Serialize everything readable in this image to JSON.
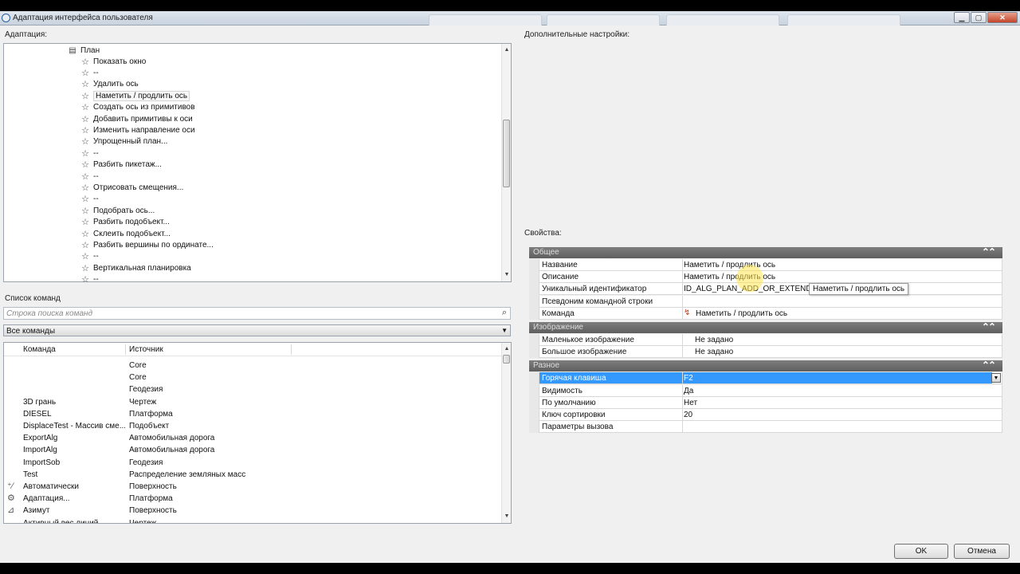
{
  "window": {
    "title": "Адаптация интерфейса пользователя",
    "controls": {
      "minimize": "▁",
      "maximize": "▢",
      "close": "✕"
    }
  },
  "left": {
    "adaptation_label": "Адаптация:",
    "tree": {
      "parent": {
        "icon": "panel-icon",
        "label": "План"
      },
      "items": [
        {
          "label": "Показать окно"
        },
        {
          "label": "--"
        },
        {
          "label": "Удалить ось"
        },
        {
          "label": "Наметить / продлить ось",
          "selected": true
        },
        {
          "label": "Создать ось из примитивов"
        },
        {
          "label": "Добавить примитивы к оси"
        },
        {
          "label": "Изменить направление оси"
        },
        {
          "label": "Упрощенный план..."
        },
        {
          "label": "--"
        },
        {
          "label": "Разбить пикетаж..."
        },
        {
          "label": "--"
        },
        {
          "label": "Отрисовать смещения..."
        },
        {
          "label": "--"
        },
        {
          "label": "Подобрать ось..."
        },
        {
          "label": "Разбить подобъект..."
        },
        {
          "label": "Склеить подобъект..."
        },
        {
          "label": "Разбить вершины по ординате..."
        },
        {
          "label": "--"
        },
        {
          "label": "Вертикальная планировка"
        },
        {
          "label": "--"
        }
      ],
      "star_glyph": "☆"
    },
    "commands_label": "Список команд",
    "search_placeholder": "Строка поиска команд",
    "filter_value": "Все команды",
    "grid": {
      "headers": [
        "Команда",
        "Источник"
      ],
      "rows": [
        {
          "command": "",
          "source": "Core",
          "icon": ""
        },
        {
          "command": "",
          "source": "Core",
          "icon": ""
        },
        {
          "command": "",
          "source": "Геодезия",
          "icon": ""
        },
        {
          "command": "3D грань",
          "source": "Чертеж",
          "icon": ""
        },
        {
          "command": "DIESEL",
          "source": "Платформа",
          "icon": ""
        },
        {
          "command": "DisplaceTest - Массив сме...",
          "source": "Подобъект",
          "icon": ""
        },
        {
          "command": "ExportAlg",
          "source": "Автомобильная дорога",
          "icon": ""
        },
        {
          "command": "ImportAlg",
          "source": "Автомобильная дорога",
          "icon": ""
        },
        {
          "command": "ImportSob",
          "source": "Геодезия",
          "icon": ""
        },
        {
          "command": "Test",
          "source": "Распределение земляных масс",
          "icon": ""
        },
        {
          "command": "Автоматически",
          "source": "Поверхность",
          "icon": "⁺⁄"
        },
        {
          "command": "Адаптация...",
          "source": "Платформа",
          "icon": "⚙"
        },
        {
          "command": "Азимут",
          "source": "Поверхность",
          "icon": "⊿"
        },
        {
          "command": "Активный вес линий",
          "source": "Чертеж",
          "icon": ""
        }
      ]
    }
  },
  "right": {
    "extra_label": "Дополнительные настройки:",
    "props_label": "Свойства:",
    "categories": [
      {
        "title": "Общее",
        "rows": [
          {
            "name": "Название",
            "value": "Наметить / продлить ось"
          },
          {
            "name": "Описание",
            "value": "Наметить / продлить ось"
          },
          {
            "name": "Уникальный идентификатор",
            "value": "ID_ALG_PLAN_ADD_OR_EXTEND"
          },
          {
            "name": "Псевдоним командной строки",
            "value": ""
          },
          {
            "name": "Команда",
            "value": "Наметить / продлить ось"
          }
        ]
      },
      {
        "title": "Изображение",
        "rows": [
          {
            "name": "Маленькое изображение",
            "value": "Не задано"
          },
          {
            "name": "Большое изображение",
            "value": "Не задано"
          }
        ]
      },
      {
        "title": "Разное",
        "rows": [
          {
            "name": "Горячая клавиша",
            "value": "F2"
          },
          {
            "name": "Видимость",
            "value": "Да"
          },
          {
            "name": "По умолчанию",
            "value": "Нет"
          },
          {
            "name": "Ключ сортировки",
            "value": "20"
          },
          {
            "name": "Параметры вызова",
            "value": ""
          }
        ]
      }
    ],
    "collapse_glyph": "⌃⌃",
    "tooltip": "Наметить / продлить ось"
  },
  "buttons": {
    "ok": "OK",
    "cancel": "Отмена"
  }
}
